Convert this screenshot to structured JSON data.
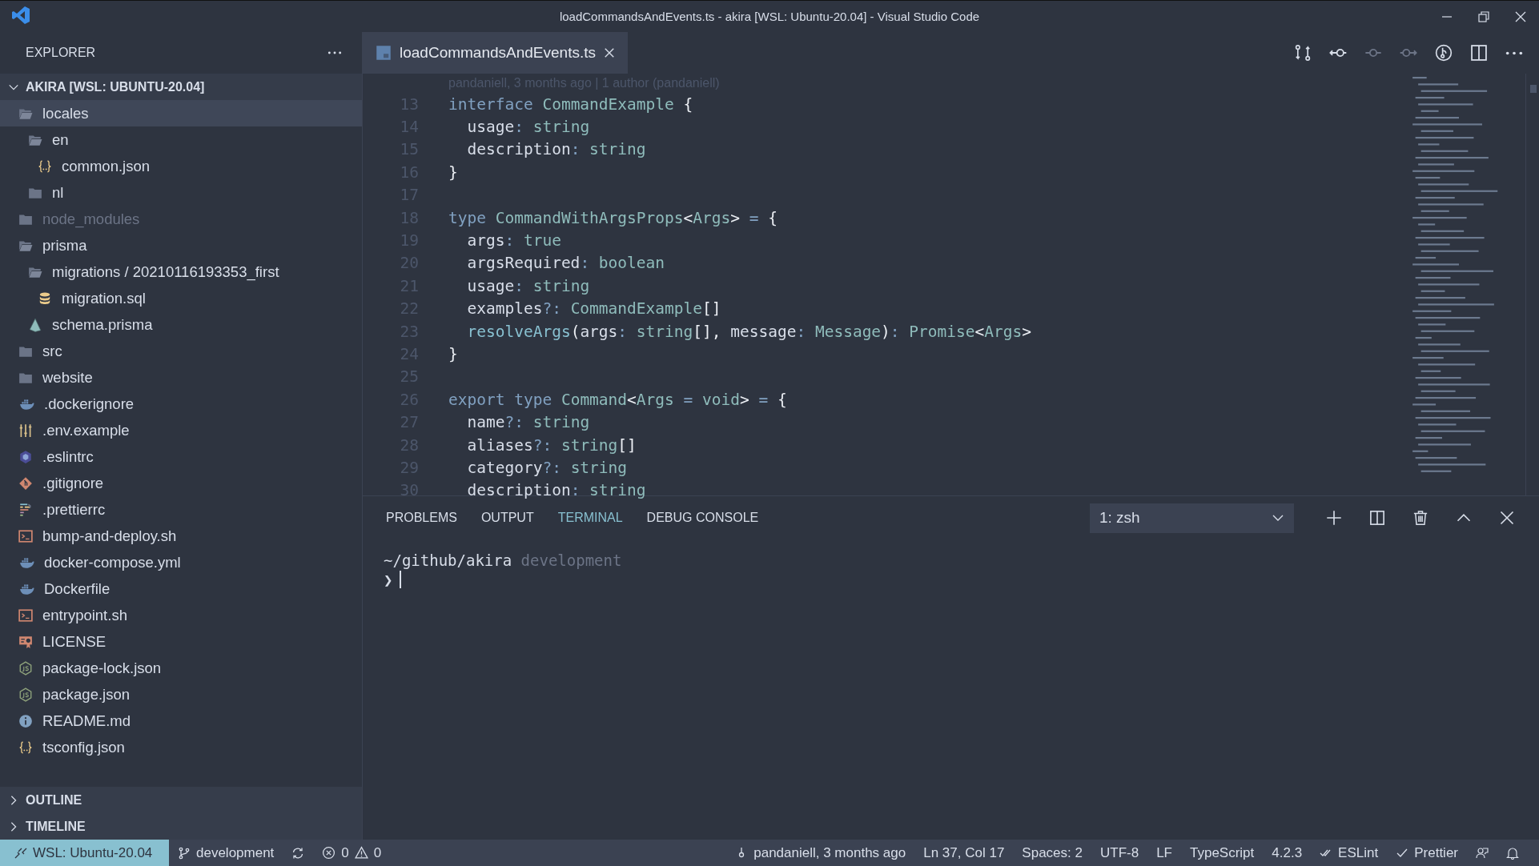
{
  "window": {
    "title": "loadCommandsAndEvents.ts - akira [WSL: Ubuntu-20.04] - Visual Studio Code"
  },
  "sidebar": {
    "title": "EXPLORER",
    "root": {
      "label": "AKIRA [WSL: UBUNTU-20.04]",
      "expanded": true
    },
    "items": [
      {
        "label": "locales",
        "kind": "folder",
        "expanded": true,
        "selected": true,
        "ignored": false,
        "children": [
          {
            "label": "en",
            "kind": "folder",
            "expanded": true,
            "selected": false,
            "ignored": false,
            "children": [
              {
                "label": "common.json",
                "kind": "json",
                "selected": false,
                "ignored": false
              }
            ]
          },
          {
            "label": "nl",
            "kind": "folder",
            "expanded": false,
            "selected": false,
            "ignored": false
          }
        ]
      },
      {
        "label": "node_modules",
        "kind": "folder",
        "expanded": false,
        "selected": false,
        "ignored": true
      },
      {
        "label": "prisma",
        "kind": "folder",
        "expanded": true,
        "selected": false,
        "ignored": false,
        "children": [
          {
            "label": "migrations / 20210116193353_first",
            "kind": "folder",
            "expanded": true,
            "selected": false,
            "ignored": false,
            "children": [
              {
                "label": "migration.sql",
                "kind": "database",
                "selected": false,
                "ignored": false
              }
            ]
          },
          {
            "label": "schema.prisma",
            "kind": "prisma",
            "selected": false,
            "ignored": false
          }
        ]
      },
      {
        "label": "src",
        "kind": "folder",
        "expanded": false,
        "selected": false,
        "ignored": false
      },
      {
        "label": "website",
        "kind": "folder",
        "expanded": false,
        "selected": false,
        "ignored": false
      },
      {
        "label": ".dockerignore",
        "kind": "docker",
        "selected": false,
        "ignored": false
      },
      {
        "label": ".env.example",
        "kind": "settings",
        "selected": false,
        "ignored": false
      },
      {
        "label": ".eslintrc",
        "kind": "eslint",
        "selected": false,
        "ignored": false
      },
      {
        "label": ".gitignore",
        "kind": "git",
        "selected": false,
        "ignored": false
      },
      {
        "label": ".prettierrc",
        "kind": "prettier",
        "selected": false,
        "ignored": false
      },
      {
        "label": "bump-and-deploy.sh",
        "kind": "shell",
        "selected": false,
        "ignored": false
      },
      {
        "label": "docker-compose.yml",
        "kind": "docker",
        "selected": false,
        "ignored": false
      },
      {
        "label": "Dockerfile",
        "kind": "docker",
        "selected": false,
        "ignored": false
      },
      {
        "label": "entrypoint.sh",
        "kind": "shell",
        "selected": false,
        "ignored": false
      },
      {
        "label": "LICENSE",
        "kind": "license",
        "selected": false,
        "ignored": false
      },
      {
        "label": "package-lock.json",
        "kind": "node",
        "selected": false,
        "ignored": false
      },
      {
        "label": "package.json",
        "kind": "node",
        "selected": false,
        "ignored": false
      },
      {
        "label": "README.md",
        "kind": "info",
        "selected": false,
        "ignored": false
      },
      {
        "label": "tsconfig.json",
        "kind": "json",
        "selected": false,
        "ignored": false
      }
    ],
    "sections": [
      {
        "label": "OUTLINE",
        "expanded": false
      },
      {
        "label": "TIMELINE",
        "expanded": false
      }
    ]
  },
  "tabs": [
    {
      "label": "loadCommandsAndEvents.ts",
      "selected": true
    }
  ],
  "editor_actions": [
    {
      "kind": "compare",
      "disabled": false
    },
    {
      "kind": "previous",
      "disabled": false
    },
    {
      "kind": "commit",
      "disabled": true
    },
    {
      "kind": "next",
      "disabled": true
    },
    {
      "kind": "history",
      "disabled": false
    },
    {
      "kind": "split",
      "disabled": false
    },
    {
      "kind": "more",
      "disabled": false
    }
  ],
  "editor": {
    "codelens": "pandaniell, 3 months ago | 1 author (pandaniell)",
    "lines": [
      {
        "n": "13",
        "tokens": [
          {
            "text": "interface",
            "kind": "keyword"
          },
          {
            "text": " CommandExample",
            "kind": "type"
          },
          {
            "text": " {",
            "kind": "bracket"
          }
        ]
      },
      {
        "n": "14",
        "tokens": [
          {
            "text": "  usage",
            "kind": "property"
          },
          {
            "text": ":",
            "kind": "operator"
          },
          {
            "text": " string",
            "kind": "type"
          }
        ]
      },
      {
        "n": "15",
        "tokens": [
          {
            "text": "  description",
            "kind": "property"
          },
          {
            "text": ":",
            "kind": "operator"
          },
          {
            "text": " string",
            "kind": "type"
          }
        ]
      },
      {
        "n": "16",
        "tokens": [
          {
            "text": "}",
            "kind": "bracket"
          }
        ]
      },
      {
        "n": "17"
      },
      {
        "n": "18",
        "tokens": [
          {
            "text": "type",
            "kind": "keyword"
          },
          {
            "text": " CommandWithArgsProps",
            "kind": "type"
          },
          {
            "text": "<",
            "kind": "bracket"
          },
          {
            "text": "Args",
            "kind": "type"
          },
          {
            "text": ">",
            "kind": "bracket"
          },
          {
            "text": " =",
            "kind": "operator"
          },
          {
            "text": " {",
            "kind": "bracket"
          }
        ]
      },
      {
        "n": "19",
        "tokens": [
          {
            "text": "  args",
            "kind": "property"
          },
          {
            "text": ":",
            "kind": "operator"
          },
          {
            "text": " true",
            "kind": "type"
          }
        ]
      },
      {
        "n": "20",
        "tokens": [
          {
            "text": "  argsRequired",
            "kind": "property"
          },
          {
            "text": ":",
            "kind": "operator"
          },
          {
            "text": " boolean",
            "kind": "type"
          }
        ]
      },
      {
        "n": "21",
        "tokens": [
          {
            "text": "  usage",
            "kind": "property"
          },
          {
            "text": ":",
            "kind": "operator"
          },
          {
            "text": " string",
            "kind": "type"
          }
        ]
      },
      {
        "n": "22",
        "tokens": [
          {
            "text": "  examples",
            "kind": "property"
          },
          {
            "text": "?:",
            "kind": "operator"
          },
          {
            "text": " CommandExample",
            "kind": "type"
          },
          {
            "text": "[]",
            "kind": "bracket"
          }
        ]
      },
      {
        "n": "23",
        "tokens": [
          {
            "text": "  resolveArgs",
            "kind": "function"
          },
          {
            "text": "(",
            "kind": "bracket"
          },
          {
            "text": "args",
            "kind": "property"
          },
          {
            "text": ":",
            "kind": "operator"
          },
          {
            "text": " string",
            "kind": "type"
          },
          {
            "text": "[], ",
            "kind": "bracket"
          },
          {
            "text": "message",
            "kind": "property"
          },
          {
            "text": ":",
            "kind": "operator"
          },
          {
            "text": " Message",
            "kind": "type"
          },
          {
            "text": ")",
            "kind": "bracket"
          },
          {
            "text": ":",
            "kind": "operator"
          },
          {
            "text": " Promise",
            "kind": "type"
          },
          {
            "text": "<",
            "kind": "bracket"
          },
          {
            "text": "Args",
            "kind": "type"
          },
          {
            "text": ">",
            "kind": "bracket"
          }
        ]
      },
      {
        "n": "24",
        "tokens": [
          {
            "text": "}",
            "kind": "bracket"
          }
        ]
      },
      {
        "n": "25"
      },
      {
        "n": "26",
        "tokens": [
          {
            "text": "export",
            "kind": "keyword"
          },
          {
            "text": " type",
            "kind": "keyword"
          },
          {
            "text": " Command",
            "kind": "type"
          },
          {
            "text": "<",
            "kind": "bracket"
          },
          {
            "text": "Args",
            "kind": "type"
          },
          {
            "text": " =",
            "kind": "operator"
          },
          {
            "text": " void",
            "kind": "type"
          },
          {
            "text": ">",
            "kind": "bracket"
          },
          {
            "text": " =",
            "kind": "operator"
          },
          {
            "text": " {",
            "kind": "bracket"
          }
        ]
      },
      {
        "n": "27",
        "tokens": [
          {
            "text": "  name",
            "kind": "property"
          },
          {
            "text": "?:",
            "kind": "operator"
          },
          {
            "text": " string",
            "kind": "type"
          }
        ]
      },
      {
        "n": "28",
        "tokens": [
          {
            "text": "  aliases",
            "kind": "property"
          },
          {
            "text": "?:",
            "kind": "operator"
          },
          {
            "text": " string",
            "kind": "type"
          },
          {
            "text": "[]",
            "kind": "bracket"
          }
        ]
      },
      {
        "n": "29",
        "tokens": [
          {
            "text": "  category",
            "kind": "property"
          },
          {
            "text": "?:",
            "kind": "operator"
          },
          {
            "text": " string",
            "kind": "type"
          }
        ]
      },
      {
        "n": "30",
        "tokens": [
          {
            "text": "  description",
            "kind": "property"
          },
          {
            "text": ":",
            "kind": "operator"
          },
          {
            "text": " string",
            "kind": "type"
          }
        ]
      }
    ]
  },
  "panel": {
    "tabs": [
      {
        "label": "PROBLEMS",
        "selected": false
      },
      {
        "label": "OUTPUT",
        "selected": false
      },
      {
        "label": "TERMINAL",
        "selected": true
      },
      {
        "label": "DEBUG CONSOLE",
        "selected": false
      }
    ],
    "terminal_select": "1: zsh",
    "actions": [
      {
        "kind": "add"
      },
      {
        "kind": "split"
      },
      {
        "kind": "trash"
      },
      {
        "kind": "maximize"
      },
      {
        "kind": "close"
      }
    ],
    "terminal": {
      "path": "~/github/akira",
      "branch": "development",
      "prompt": "❯"
    }
  },
  "status_bar": {
    "left": [
      {
        "kind": "remote",
        "text": "WSL: Ubuntu-20.04"
      },
      {
        "kind": "branch",
        "text": "development"
      },
      {
        "kind": "sync"
      },
      {
        "kind": "problems",
        "errors": "0",
        "warnings": "0"
      }
    ],
    "right": [
      {
        "kind": "blame",
        "text": "pandaniell, 3 months ago"
      },
      {
        "kind": "text",
        "text": "Ln 37, Col 17"
      },
      {
        "kind": "text",
        "text": "Spaces: 2"
      },
      {
        "kind": "text",
        "text": "UTF-8"
      },
      {
        "kind": "text",
        "text": "LF"
      },
      {
        "kind": "text",
        "text": "TypeScript"
      },
      {
        "kind": "text",
        "text": "4.2.3"
      },
      {
        "kind": "double-check",
        "text": "ESLint"
      },
      {
        "kind": "check",
        "text": "Prettier"
      },
      {
        "kind": "feedback"
      },
      {
        "kind": "bell"
      }
    ]
  }
}
